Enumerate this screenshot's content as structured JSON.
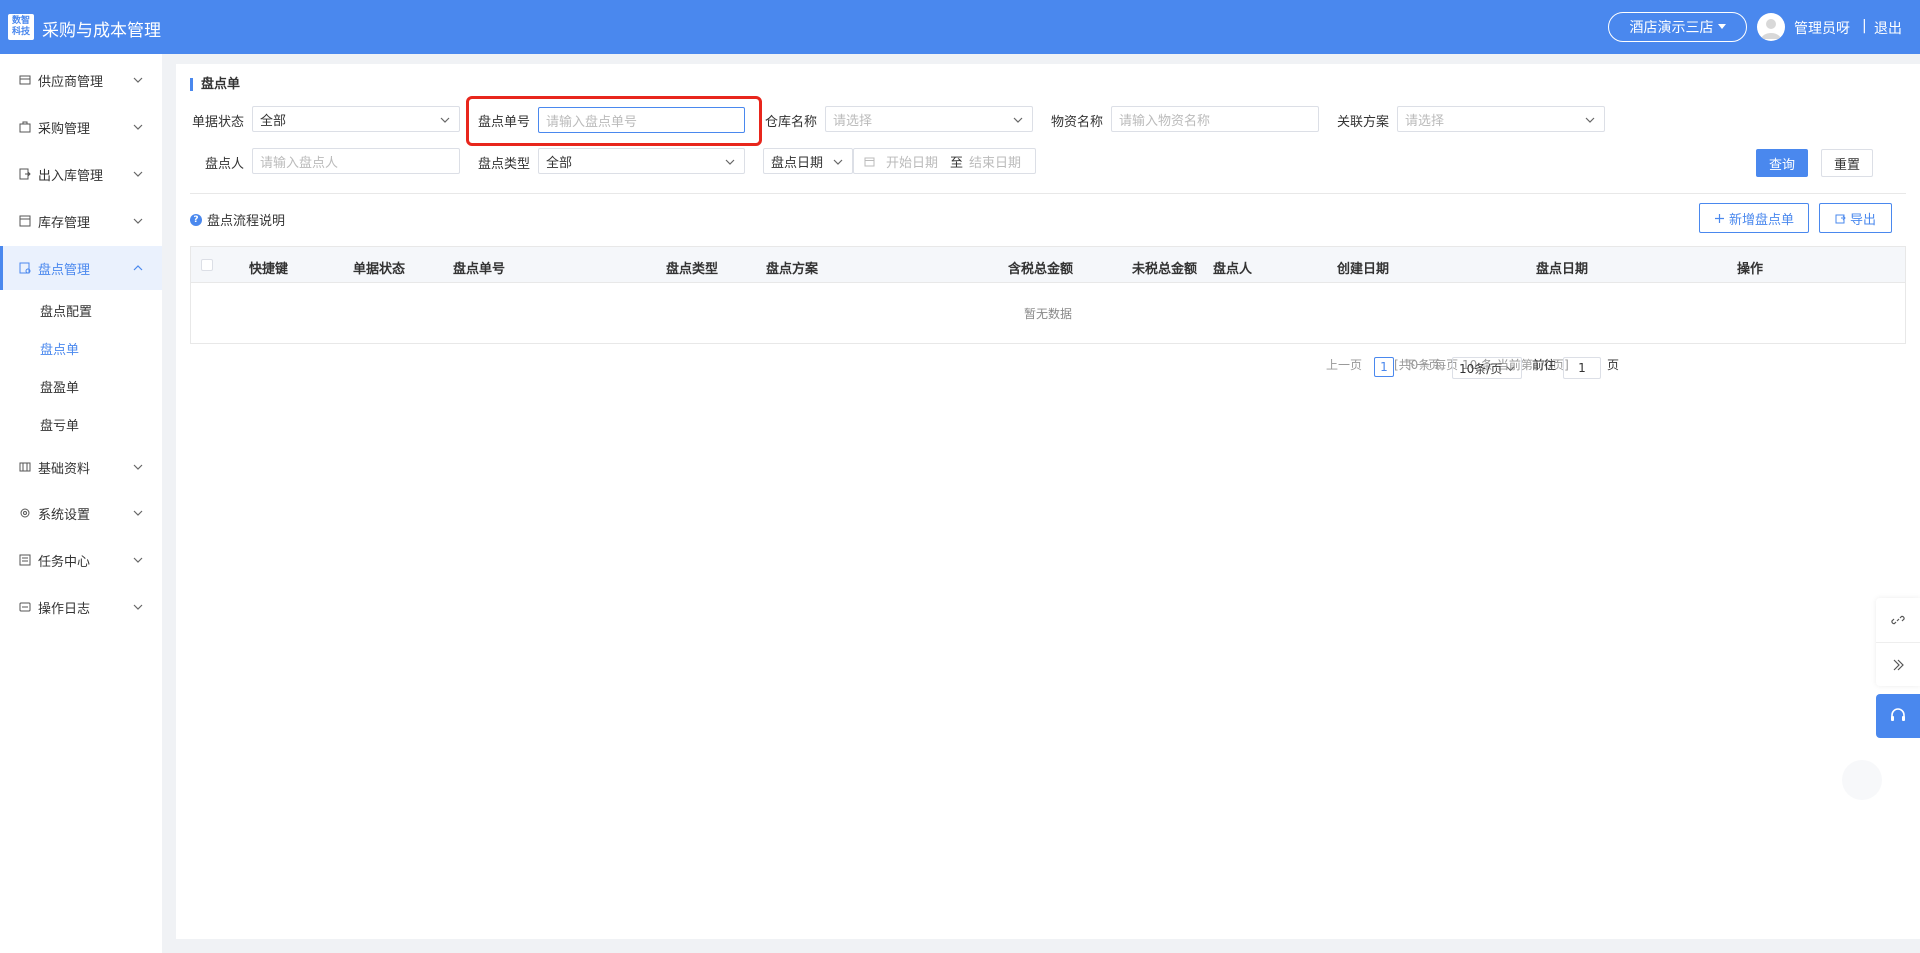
{
  "header": {
    "logo_text": "数智科技",
    "title": "采购与成本管理",
    "store": "酒店演示三店",
    "user": "管理员呀",
    "separator": "|",
    "logout": "退出"
  },
  "sidebar": {
    "items": [
      {
        "label": "供应商管理",
        "icon": "supplier-icon"
      },
      {
        "label": "采购管理",
        "icon": "purchase-icon"
      },
      {
        "label": "出入库管理",
        "icon": "stock-in-out-icon"
      },
      {
        "label": "库存管理",
        "icon": "inventory-icon"
      },
      {
        "label": "盘点管理",
        "icon": "stocktake-icon",
        "active": true
      },
      {
        "label": "基础资料",
        "icon": "basic-data-icon"
      },
      {
        "label": "系统设置",
        "icon": "settings-icon"
      },
      {
        "label": "任务中心",
        "icon": "task-icon"
      },
      {
        "label": "操作日志",
        "icon": "log-icon"
      }
    ],
    "sub_items": [
      {
        "label": "盘点配置"
      },
      {
        "label": "盘点单",
        "active": true
      },
      {
        "label": "盘盈单"
      },
      {
        "label": "盘亏单"
      }
    ]
  },
  "page": {
    "title": "盘点单",
    "filters": {
      "status_label": "单据状态",
      "status_value": "全部",
      "order_no_label": "盘点单号",
      "order_no_placeholder": "请输入盘点单号",
      "warehouse_label": "仓库名称",
      "warehouse_placeholder": "请选择",
      "material_label": "物资名称",
      "material_placeholder": "请输入物资名称",
      "plan_label": "关联方案",
      "plan_placeholder": "请选择",
      "person_label": "盘点人",
      "person_placeholder": "请输入盘点人",
      "type_label": "盘点类型",
      "type_value": "全部",
      "date_type": "盘点日期",
      "start_placeholder": "开始日期",
      "range_sep": "至",
      "end_placeholder": "结束日期"
    },
    "buttons": {
      "query": "查询",
      "reset": "重置",
      "add": "新增盘点单",
      "export": "导出"
    },
    "help_text": "盘点流程说明",
    "table": {
      "columns": [
        "快捷键",
        "单据状态",
        "盘点单号",
        "盘点类型",
        "盘点方案",
        "含税总金额",
        "未税总金额",
        "盘点人",
        "创建日期",
        "盘点日期",
        "操作"
      ],
      "empty_text": "暂无数据"
    },
    "pagination": {
      "summary": "[共0条 每页 10 条 当前第1/0页]",
      "prev": "上一页",
      "current": "1",
      "next": "下一页",
      "page_size": "10条/页",
      "goto_label": "前往",
      "goto_value": "1",
      "page_unit": "页"
    }
  },
  "colors": {
    "primary": "#4a88ee",
    "highlight": "#e8261c"
  }
}
